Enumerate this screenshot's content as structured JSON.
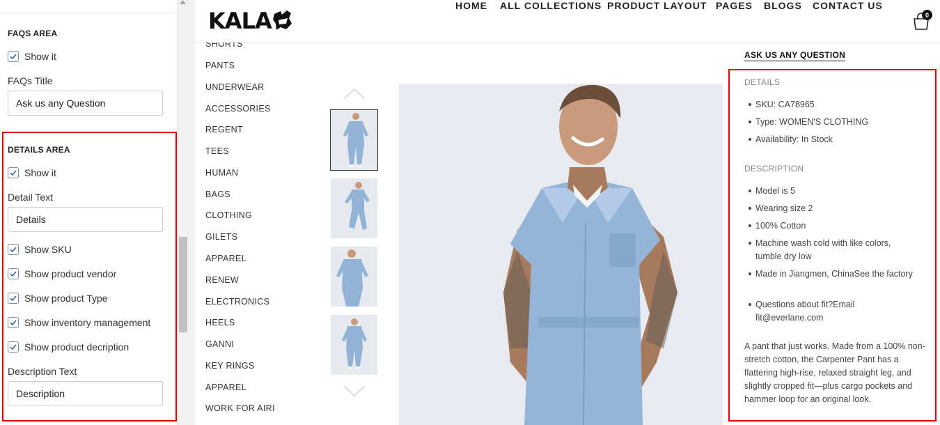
{
  "settings": {
    "faqs": {
      "heading": "FAQS AREA",
      "show_label": "Show it",
      "title_label": "FAQs Title",
      "title_value": "Ask us any Question"
    },
    "details": {
      "heading": "DETAILS AREA",
      "show_label": "Show it",
      "detail_text_label": "Detail Text",
      "detail_text_value": "Details",
      "show_sku": "Show SKU",
      "show_vendor": "Show product vendor",
      "show_type": "Show product Type",
      "show_inventory": "Show inventory management",
      "show_description": "Show product decription",
      "description_text_label": "Description Text",
      "description_text_value": "Description"
    },
    "highlight_color": "#e00000"
  },
  "store": {
    "logo": "KALA",
    "nav": [
      "HOME",
      "ALL COLLECTIONS",
      "PRODUCT LAYOUT",
      "PAGES",
      "BLOGS",
      "CONTACT US"
    ],
    "cart_count": "0",
    "categories": [
      "SHORTS",
      "PANTS",
      "UNDERWEAR",
      "ACCESSORIES",
      "REGENT",
      "TEES",
      "HUMAN",
      "BAGS",
      "CLOTHING",
      "GILETS",
      "APPAREL",
      "RENEW",
      "ELECTRONICS",
      "HEELS",
      "GANNI",
      "KEY RINGS",
      "APPAREL",
      "WORK FOR AIRI"
    ],
    "ask_question": "ASK US ANY QUESTION",
    "details_heading": "DETAILS",
    "details_items": [
      "SKU: CA78965",
      "Type: WOMEN'S CLOTHING",
      "Availability: In Stock"
    ],
    "description_heading": "DESCRIPTION",
    "description_items": [
      "Model is 5",
      "Wearing size 2",
      "100% Cotton",
      "Machine wash cold with like colors, tumble dry low",
      "Made in Jiangmen, ChinaSee the factory",
      "Questions about fit?Email fit@everlane.com"
    ],
    "description_paragraph": "A pant that just works. Made from a 100% non-stretch cotton, the Carpenter Pant has a flattering high-rise, relaxed straight leg, and slightly cropped fit—plus cargo pockets and hammer loop for an original look."
  }
}
